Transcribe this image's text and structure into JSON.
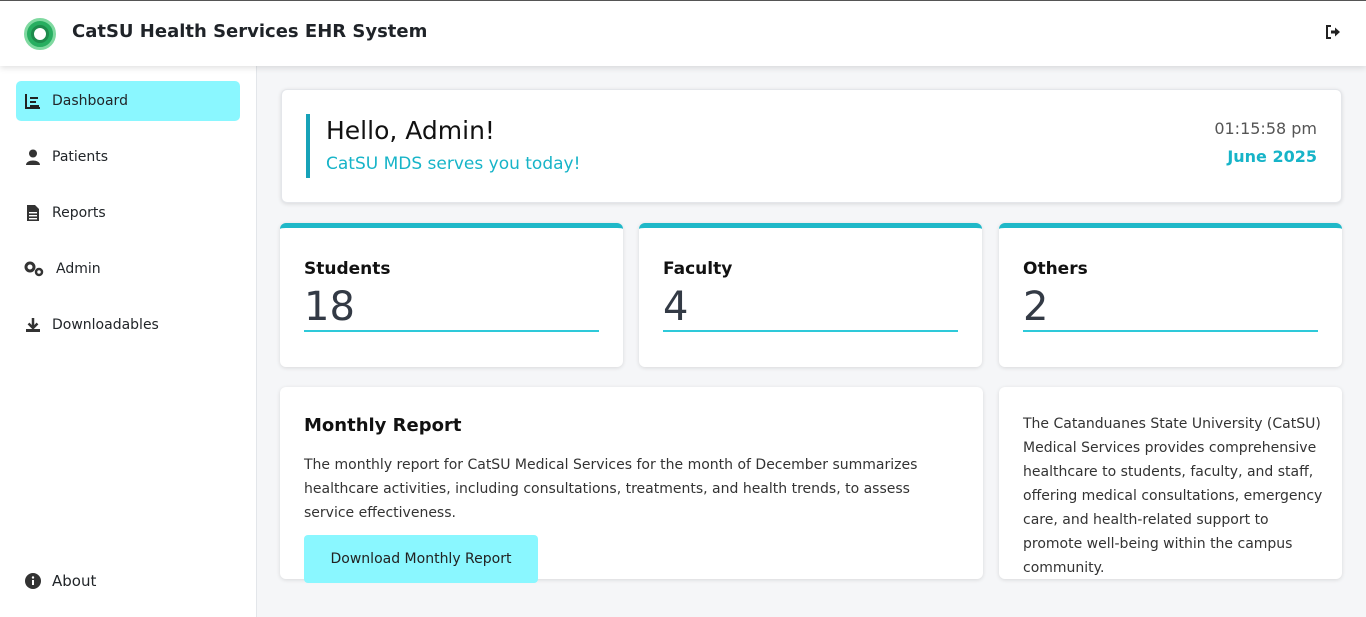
{
  "header": {
    "app_title": "CatSU Health Services EHR System",
    "logout_icon": "sign-out-icon"
  },
  "sidebar": {
    "items": [
      {
        "label": "Dashboard",
        "icon": "chart-icon",
        "active": true
      },
      {
        "label": "Patients",
        "icon": "user-icon"
      },
      {
        "label": "Reports",
        "icon": "file-icon"
      },
      {
        "label": "Admin",
        "icon": "cogs-icon"
      },
      {
        "label": "Downloadables",
        "icon": "download-icon"
      }
    ],
    "about": {
      "label": "About",
      "icon": "info-icon"
    }
  },
  "greeting": {
    "title": "Hello, Admin!",
    "subtitle": "CatSU MDS serves you today!",
    "time": "01:15:58 pm",
    "date": "June 2025"
  },
  "stats": [
    {
      "label": "Students",
      "value": "18"
    },
    {
      "label": "Faculty",
      "value": "4"
    },
    {
      "label": "Others",
      "value": "2"
    }
  ],
  "report": {
    "title": "Monthly Report",
    "text": "The monthly report for CatSU Medical Services for the month of December summarizes healthcare activities, including consultations, treatments, and health trends, to assess service effectiveness.",
    "button_label": "Download Monthly Report"
  },
  "about_card": {
    "text": "The Catanduanes State University (CatSU) Medical Services provides comprehensive healthcare to students, faculty, and staff, offering medical consultations, emergency care, and health-related support to promote well-being within the campus community."
  },
  "colors": {
    "accent": "#17b4c8",
    "active_bg": "#8af7ff",
    "card_top_border": "#1fb8c8"
  }
}
